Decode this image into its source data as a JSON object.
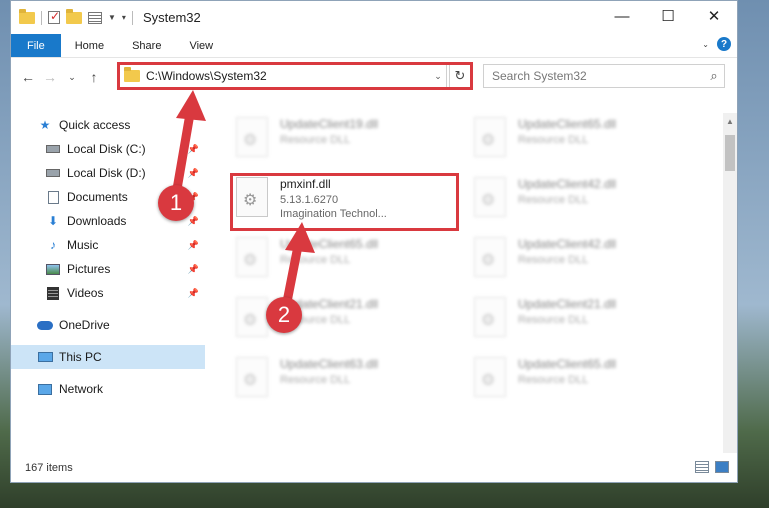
{
  "window": {
    "title": "System32"
  },
  "ribbon": {
    "tabs": [
      "File",
      "Home",
      "Share",
      "View"
    ]
  },
  "address": {
    "path": "C:\\Windows\\System32"
  },
  "search": {
    "placeholder": "Search System32"
  },
  "sidebar": {
    "items": [
      {
        "label": "Quick access",
        "icon": "quick-access-star-icon"
      },
      {
        "label": "Local Disk (C:)",
        "icon": "disk-icon",
        "pinned": true
      },
      {
        "label": "Local Disk (D:)",
        "icon": "disk-icon",
        "pinned": true
      },
      {
        "label": "Documents",
        "icon": "documents-icon",
        "pinned": true
      },
      {
        "label": "Downloads",
        "icon": "downloads-icon",
        "pinned": true
      },
      {
        "label": "Music",
        "icon": "music-icon",
        "pinned": true
      },
      {
        "label": "Pictures",
        "icon": "pictures-icon",
        "pinned": true
      },
      {
        "label": "Videos",
        "icon": "videos-icon",
        "pinned": true
      },
      {
        "label": "OneDrive",
        "icon": "onedrive-cloud-icon"
      },
      {
        "label": "This PC",
        "icon": "this-pc-icon",
        "selected": true
      },
      {
        "label": "Network",
        "icon": "network-icon"
      }
    ]
  },
  "files": {
    "highlighted": {
      "name": "pmxinf.dll",
      "version": "5.13.1.6270",
      "company": "Imagination Technol..."
    },
    "others": [
      {
        "name": "UpdateClient19.dll",
        "type": "Resource DLL"
      },
      {
        "name": "UpdateClient65.dll",
        "type": "Resource DLL"
      },
      {
        "name": "UpdateClient42.dll",
        "type": "Resource DLL"
      },
      {
        "name": "UpdateClient65.dll",
        "type": "Resource DLL"
      },
      {
        "name": "UpdateClient42.dll",
        "type": "Resource DLL"
      },
      {
        "name": "UpdateClient21.dll",
        "type": "Resource DLL"
      },
      {
        "name": "UpdateClient21.dll",
        "type": "Resource DLL"
      },
      {
        "name": "UpdateClient63.dll",
        "type": "Resource DLL"
      },
      {
        "name": "UpdateClient65.dll",
        "type": "Resource DLL"
      }
    ]
  },
  "status": {
    "item_count": "167 items"
  },
  "annotations": {
    "step1": "1",
    "step2": "2",
    "color": "#d9393f"
  }
}
